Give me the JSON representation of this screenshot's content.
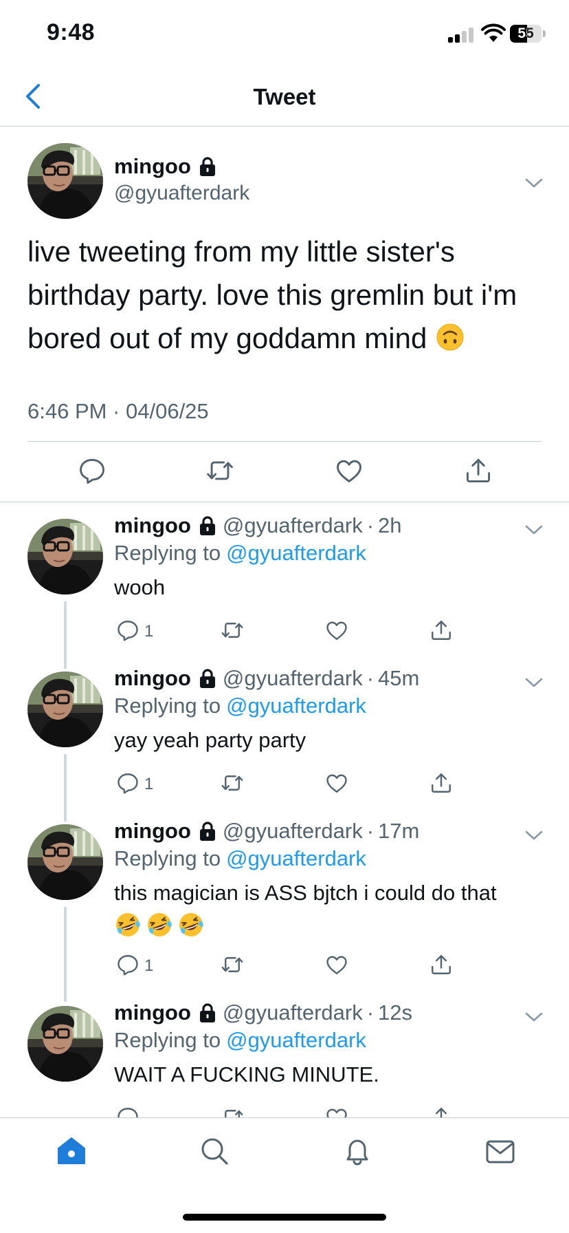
{
  "status_bar": {
    "time": "9:48",
    "battery": "55",
    "battery_level": 0.55
  },
  "header": {
    "title": "Tweet"
  },
  "main_tweet": {
    "name": "mingoo",
    "handle": "@gyuafterdark",
    "text": "live tweeting from my little sister's birthday party. love this gremlin but i'm bored out of my goddamn mind",
    "emoji": "upside-down-face",
    "timestamp": "6:46 PM · 04/06/25"
  },
  "replies": [
    {
      "name": "mingoo",
      "handle": "@gyuafterdark",
      "time": "2h",
      "replying_label": "Replying to",
      "replying_handle": "@gyuafterdark",
      "text": "wooh",
      "reply_count": "1"
    },
    {
      "name": "mingoo",
      "handle": "@gyuafterdark",
      "time": "45m",
      "replying_label": "Replying to",
      "replying_handle": "@gyuafterdark",
      "text": "yay yeah party party",
      "reply_count": "1"
    },
    {
      "name": "mingoo",
      "handle": "@gyuafterdark",
      "time": "17m",
      "replying_label": "Replying to",
      "replying_handle": "@gyuafterdark",
      "text": "this magician is ASS bjtch i could do that",
      "emojis": [
        "rolling-on-floor-laughing",
        "rolling-on-floor-laughing",
        "rolling-on-floor-laughing"
      ],
      "reply_count": "1"
    },
    {
      "name": "mingoo",
      "handle": "@gyuafterdark",
      "time": "12s",
      "replying_label": "Replying to",
      "replying_handle": "@gyuafterdark",
      "text": "WAIT A FUCKING MINUTE."
    }
  ],
  "tab_bar": {
    "items": [
      "home-icon",
      "search-icon",
      "notifications-icon",
      "messages-icon"
    ],
    "active": "home-icon"
  },
  "colors": {
    "accent": "#1d9bf0",
    "secondary_text": "#536471",
    "divider": "#c8ccd0",
    "tab_active": "#1d7dd8"
  }
}
